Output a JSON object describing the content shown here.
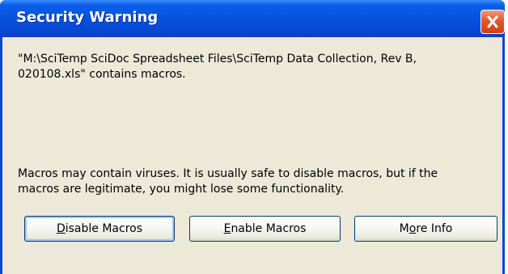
{
  "window": {
    "title": "Security Warning"
  },
  "message": {
    "line1": "\"M:\\SciTemp SciDoc Spreadsheet Files\\SciTemp Data Collection, Rev B,",
    "line2": "020108.xls\" contains macros.",
    "line3": "Macros may contain viruses. It is usually safe to disable macros, but if the",
    "line4": "macros are legitimate, you might lose some functionality."
  },
  "buttons": {
    "disable": {
      "accel": "D",
      "rest": "isable Macros"
    },
    "enable": {
      "accel": "E",
      "rest": "nable Macros"
    },
    "more": {
      "pre": "M",
      "accel": "o",
      "rest": "re Info"
    }
  },
  "icons": {
    "close": "close-icon"
  },
  "colors": {
    "titlebar": "#0750dc",
    "client": "#ece9d8",
    "close_button": "#e2582d",
    "button_border": "#003c74"
  }
}
